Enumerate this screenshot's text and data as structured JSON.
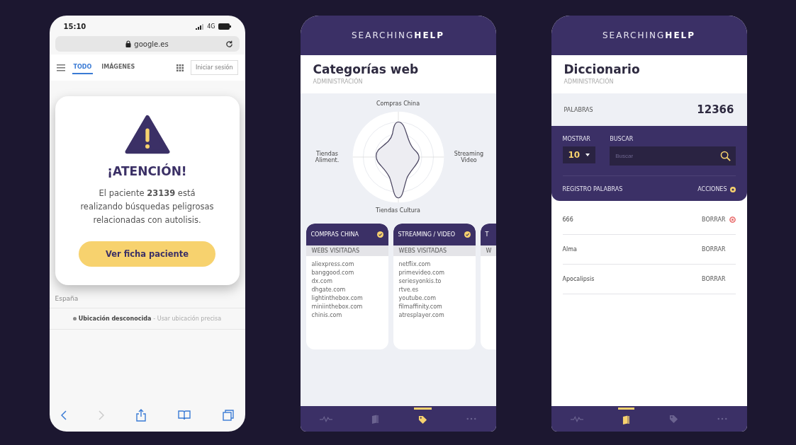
{
  "browser_phone": {
    "status_bar": {
      "time": "15:10",
      "network": "4G"
    },
    "url": "google.es",
    "nav": [
      {
        "label": "TODO",
        "selected": true
      },
      {
        "label": "IMÁGENES",
        "selected": false
      }
    ],
    "sign_in": "Iniciar sesión",
    "alert": {
      "title": "¡ATENCIÓN!",
      "message": "El paciente **23139** está realizando búsquedas peligrosas relacionadas con autolisis.",
      "button": "Ver ficha paciente"
    },
    "footer": {
      "country": "España",
      "location": "Ubicación desconocida",
      "location_action": "- Usar ubicación precisa"
    }
  },
  "categories_phone": {
    "logo": {
      "light": "SEARCHING",
      "bold": "HELP"
    },
    "title": "Categorías web",
    "subtitle": "ADMINISTRACIÓN",
    "radar_labels": {
      "top": "Compras China",
      "right": "Streaming Video",
      "bottom": "Tiendas Cultura",
      "left": "Tiendas Aliment."
    },
    "cards": [
      {
        "title": "COMPRAS CHINA",
        "subtitle": "WEBS VISITADAS",
        "sites": [
          "aliexpress.com",
          "banggood.com",
          "dx.com",
          "dhgate.com",
          "lightinthebox.com",
          "miniinthebox.com",
          "chinis.com"
        ]
      },
      {
        "title": "STREAMING / VIDEO",
        "subtitle": "WEBS VISITADAS",
        "sites": [
          "netflix.com",
          "primevideo.com",
          "seriesyonkis.to",
          "rtve.es",
          "youtube.com",
          "filmaffinity.com",
          "atresplayer.com"
        ]
      },
      {
        "title": "T",
        "subtitle": "W"
      }
    ],
    "bottom_nav": [
      {
        "kind": "pulse",
        "selected": false
      },
      {
        "kind": "book",
        "selected": false
      },
      {
        "kind": "tag",
        "selected": true
      },
      {
        "kind": "more",
        "selected": false
      }
    ]
  },
  "dictionary_phone": {
    "logo": {
      "light": "SEARCHING",
      "bold": "HELP"
    },
    "title": "Diccionario",
    "subtitle": "ADMINISTRACIÓN",
    "count_label": "PALABRAS",
    "count": "12366",
    "show_label": "MOSTRAR",
    "show_value": "10",
    "search_label": "BUSCAR",
    "search_placeholder": "Buscar",
    "list_header": "REGISTRO PALABRAS",
    "actions_label": "ACCIONES",
    "words": [
      {
        "word": "666",
        "action": "BORRAR",
        "flagged": true
      },
      {
        "word": "Alma",
        "action": "BORRAR",
        "flagged": false
      },
      {
        "word": "Apocalipsis",
        "action": "BORRAR",
        "flagged": false
      }
    ],
    "bottom_nav": [
      {
        "kind": "pulse",
        "selected": false
      },
      {
        "kind": "book",
        "selected": true
      },
      {
        "kind": "tag",
        "selected": false
      },
      {
        "kind": "more",
        "selected": false
      }
    ]
  }
}
